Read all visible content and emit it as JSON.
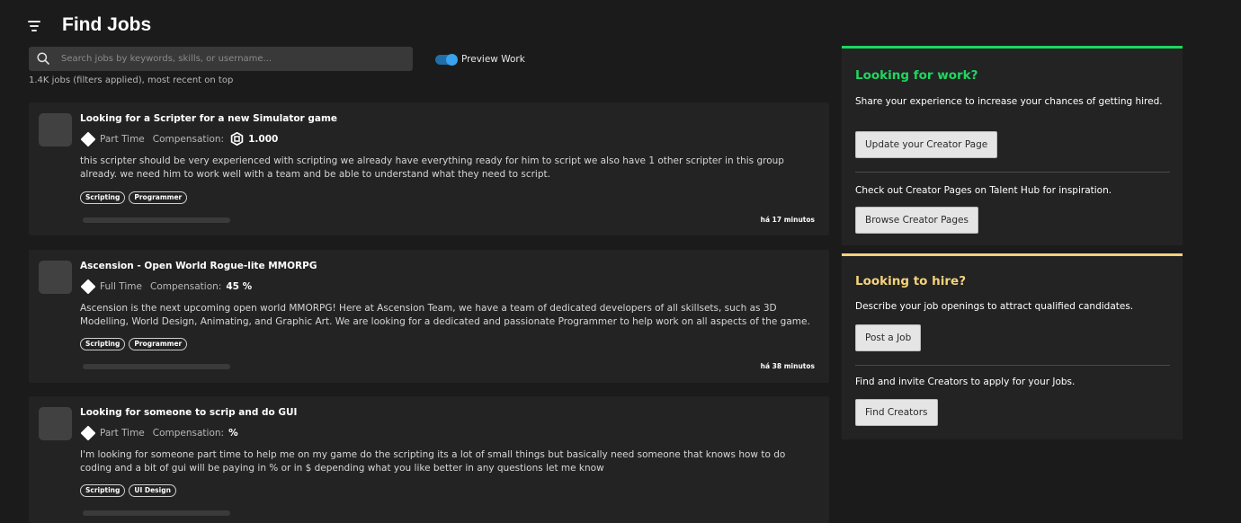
{
  "header": {
    "title": "Find Jobs"
  },
  "search": {
    "placeholder": "Search jobs by keywords, skills, or username..."
  },
  "preview_toggle": {
    "label": "Preview Work",
    "on": true
  },
  "results": {
    "summary": "1.4K jobs (filters applied), most recent on top"
  },
  "jobs": [
    {
      "title": "Looking for a Scripter for a new Simulator game",
      "type": "Part Time",
      "compensation_label": "Compensation:",
      "compensation_value": "1.000",
      "compensation_icon": "robux-icon",
      "description": "this scripter should be very experienced with scripting we already have everything ready for him to script we also have 1 other scripter in this group already. we need him to work well with a team and be able to understand what they need to script.",
      "tags": [
        "Scripting",
        "Programmer"
      ],
      "posted": "há 17 minutos"
    },
    {
      "title": "Ascension - Open World Rogue-lite MMORPG",
      "type": "Full Time",
      "compensation_label": "Compensation:",
      "compensation_value": "45 %",
      "description": "Ascension is the next upcoming open world MMORPG! Here at Ascension Team, we have a team of dedicated developers of all skillsets, such as 3D Modelling, World Design, Animating, and Graphic Art. We are looking for a dedicated and passionate Programmer to help work on all aspects of the game.",
      "tags": [
        "Scripting",
        "Programmer"
      ],
      "posted": "há 38 minutos"
    },
    {
      "title": "Looking for someone to scrip and do GUI",
      "type": "Part Time",
      "compensation_label": "Compensation:",
      "compensation_value": "%",
      "description": "I'm looking for someone part time to help me on my game do the scripting its a lot of small things but basically need someone that knows how to do coding and a bit of gui will be paying in % or in $ depending what you like better in any questions let me know",
      "tags": [
        "Scripting",
        "UI Design"
      ]
    }
  ],
  "sidebar": {
    "work": {
      "heading": "Looking for work?",
      "color": "#1ed760",
      "text1": "Share your experience to increase your chances of getting hired.",
      "button1": "Update your Creator Page",
      "text2": "Check out Creator Pages on Talent Hub for inspiration.",
      "button2": "Browse Creator Pages"
    },
    "hire": {
      "heading": "Looking to hire?",
      "color": "#f5d27a",
      "text1": "Describe your job openings to attract qualified candidates.",
      "button1": "Post a Job",
      "text2": "Find and invite Creators to apply for your Jobs.",
      "button2": "Find Creators"
    }
  }
}
